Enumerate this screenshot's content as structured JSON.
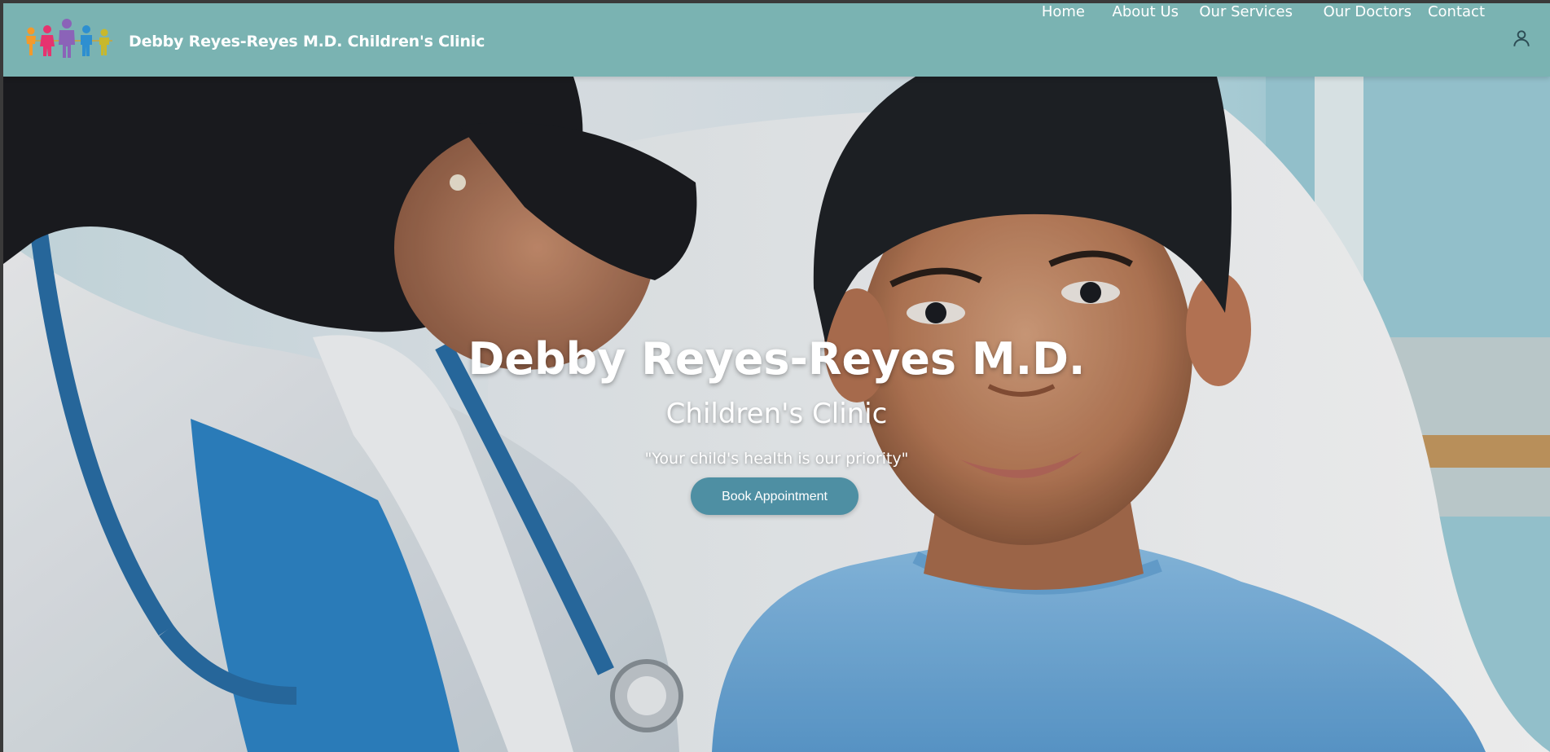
{
  "navbar": {
    "brand_name": "Debby Reyes-Reyes M.D. Children's Clinic",
    "logo_icon": "family-figures-logo",
    "links": [
      {
        "label": "Home"
      },
      {
        "label": "About Us"
      },
      {
        "label": "Our Services"
      },
      {
        "label": "Our Doctors"
      },
      {
        "label": "Contact"
      }
    ],
    "account_icon": "user-icon"
  },
  "hero": {
    "title": "Debby Reyes-Reyes M.D.",
    "subtitle": "Children's Clinic",
    "tagline": "\"Your child's health is our priority\"",
    "cta_label": "Book Appointment",
    "image_subject": "doctor-with-child-photo"
  },
  "colors": {
    "navbar_bg": "#7ab3b2",
    "cta_bg": "#4e8fa3",
    "text": "#ffffff",
    "logo_figures": [
      "#f39a2b",
      "#e6336f",
      "#8b63b8",
      "#2e8fd0",
      "#c8b82c"
    ]
  }
}
